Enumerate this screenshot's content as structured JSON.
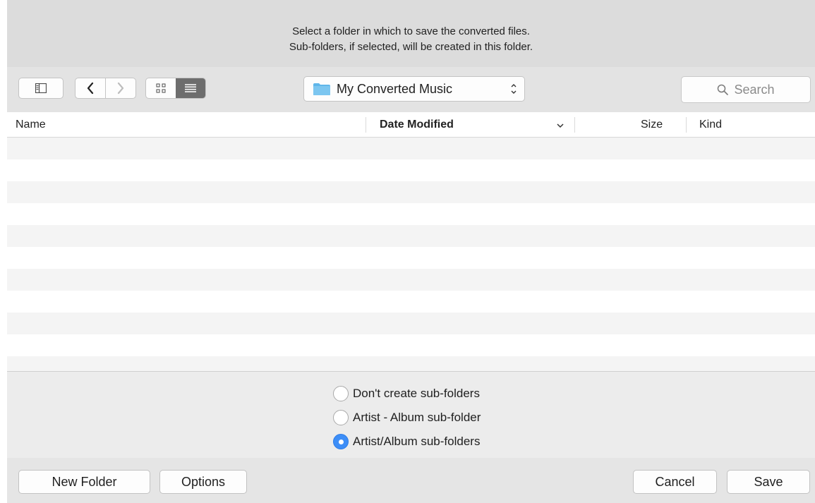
{
  "message": {
    "line1": "Select a folder in which to save the converted files.",
    "line2": "Sub-folders, if selected, will be created in this folder."
  },
  "toolbar": {
    "location": "My Converted Music",
    "search_placeholder": "Search",
    "view_mode": "list"
  },
  "columns": {
    "name": "Name",
    "date_modified": "Date Modified",
    "size": "Size",
    "kind": "Kind",
    "sort_indicator": "chevron-down-icon"
  },
  "subfolder_options": {
    "options": [
      "Don't create sub-folders",
      "Artist - Album sub-folder",
      "Artist/Album sub-folders"
    ],
    "selected": "Artist/Album sub-folders"
  },
  "buttons": {
    "new_folder": "New Folder",
    "options": "Options",
    "cancel": "Cancel",
    "save": "Save"
  },
  "colors": {
    "accent": "#3d8ef7",
    "folder": "#5fb6ea",
    "active_segment": "#6d6d6d"
  }
}
